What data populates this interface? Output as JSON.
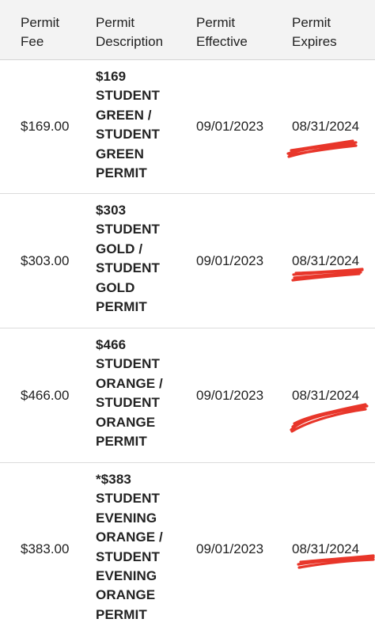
{
  "table": {
    "headers": [
      "Permit\nFee",
      "Permit\nDescription",
      "Permit\nEffective",
      "Permit\nExpires"
    ],
    "rows": [
      {
        "fee": "$169.00",
        "description": "$169 STUDENT GREEN / STUDENT GREEN PERMIT",
        "effective": "09/01/2023",
        "expires": "08/31/2024"
      },
      {
        "fee": "$303.00",
        "description": "$303 STUDENT GOLD / STUDENT GOLD PERMIT",
        "effective": "09/01/2023",
        "expires": "08/31/2024"
      },
      {
        "fee": "$466.00",
        "description": "$466 STUDENT ORANGE / STUDENT ORANGE PERMIT",
        "effective": "09/01/2023",
        "expires": "08/31/2024"
      },
      {
        "fee": "$383.00",
        "description": "*$383 STUDENT EVENING ORANGE / STUDENT EVENING ORANGE PERMIT",
        "effective": "09/01/2023",
        "expires": "08/31/2024"
      }
    ]
  },
  "annotation_color": "#e8362a"
}
